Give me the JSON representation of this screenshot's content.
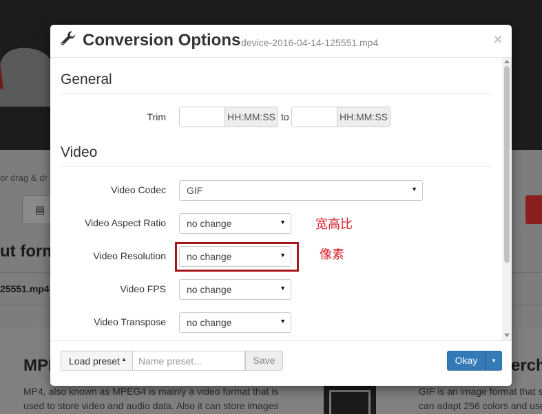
{
  "background": {
    "hint_text": "or drag & dr",
    "heading": "ut form",
    "filename": "25551.mp4",
    "mpeg_title": "MPE",
    "mpeg_text": "MP4, also known as MPEG4 is mainly a video format that is used to store video and audio data. Also it can store images",
    "right_title": "erch",
    "gif_text_line1": "GIF is an image format that su",
    "gif_text_line2": "can adapt 256 colors and uses"
  },
  "modal": {
    "title": "Conversion Options",
    "subtitle": "device-2016-04-14-125551.mp4",
    "close_label": "×",
    "general": {
      "title": "General",
      "trim_label": "Trim",
      "trim_start_value": "",
      "trim_end_value": "",
      "time_format": "HH:MM:SS",
      "to_label": "to"
    },
    "video": {
      "title": "Video",
      "codec_label": "Video Codec",
      "codec_value": "GIF",
      "aspect_label": "Video Aspect Ratio",
      "aspect_value": "no change",
      "resolution_label": "Video Resolution",
      "resolution_value": "no change",
      "fps_label": "Video FPS",
      "fps_value": "no change",
      "transpose_label": "Video Transpose",
      "transpose_value": "no change"
    },
    "annotations": {
      "aspect_note": "宽高比",
      "resolution_note": "像素"
    },
    "footer": {
      "load_preset_label": "Load preset",
      "preset_placeholder": "Name preset...",
      "save_label": "Save",
      "okay_label": "Okay"
    }
  },
  "colors": {
    "primary": "#337ab7",
    "annotation_red": "#d8232a",
    "annotation_border": "#a8141c"
  },
  "icons": {
    "title_icon": "wrench-icon",
    "dropdown": "caret-down-icon"
  }
}
